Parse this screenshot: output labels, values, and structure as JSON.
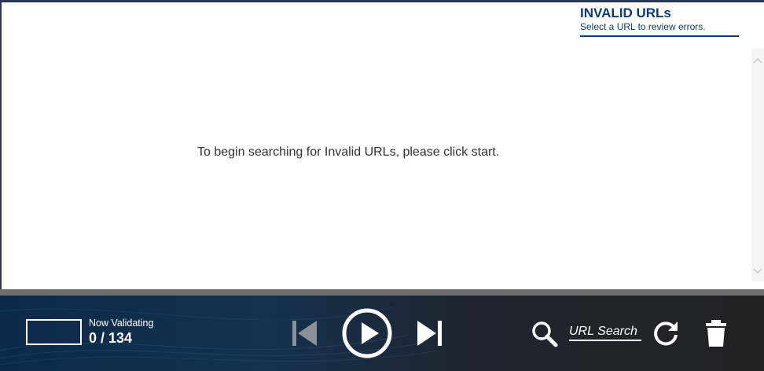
{
  "panel": {
    "title": "INVALID URLs",
    "subtitle": "Select a URL to review errors."
  },
  "main": {
    "message": "To begin searching for Invalid URLs, please click start."
  },
  "footer": {
    "now_validating_label": "Now Validating",
    "count": "0 / 134",
    "search_placeholder": "URL Search"
  },
  "icons": {
    "previous": "skip-previous-icon",
    "play": "play-circle-icon",
    "next": "skip-next-icon",
    "search": "search-icon",
    "refresh": "refresh-icon",
    "delete": "trash-icon"
  },
  "colors": {
    "accent": "#0d3d73",
    "footer_bg": "#1a2a3d",
    "disabled_control": "#8a9099"
  }
}
